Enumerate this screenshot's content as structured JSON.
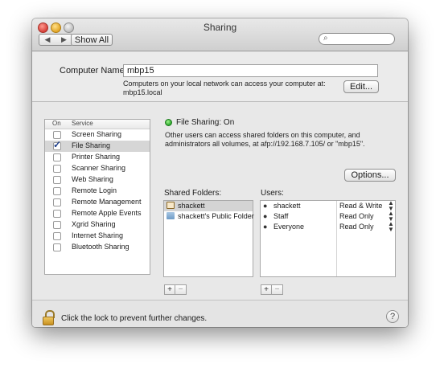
{
  "window": {
    "title": "Sharing"
  },
  "toolbar": {
    "back": "◀",
    "forward": "▶",
    "show_all": "Show All",
    "search_placeholder": ""
  },
  "computer_name": {
    "label": "Computer Name:",
    "value": "mbp15",
    "info_line1": "Computers on your local network can access your computer at:",
    "info_line2": "mbp15.local",
    "edit_label": "Edit..."
  },
  "services": {
    "header_on": "On",
    "header_service": "Service",
    "items": [
      {
        "label": "Screen Sharing",
        "on": false
      },
      {
        "label": "File Sharing",
        "on": true,
        "selected": true
      },
      {
        "label": "Printer Sharing",
        "on": false
      },
      {
        "label": "Scanner Sharing",
        "on": false
      },
      {
        "label": "Web Sharing",
        "on": false
      },
      {
        "label": "Remote Login",
        "on": false
      },
      {
        "label": "Remote Management",
        "on": false
      },
      {
        "label": "Remote Apple Events",
        "on": false
      },
      {
        "label": "Xgrid Sharing",
        "on": false
      },
      {
        "label": "Internet Sharing",
        "on": false
      },
      {
        "label": "Bluetooth Sharing",
        "on": false
      }
    ]
  },
  "detail": {
    "status": "File Sharing: On",
    "status_color": "#2aa52a",
    "description": "Other users can access shared folders on this computer, and administrators all volumes, at afp://192.168.7.105/ or \"mbp15\".",
    "options_label": "Options...",
    "shared_folders_label": "Shared Folders:",
    "users_label": "Users:",
    "folders": [
      {
        "name": "shackett",
        "icon": "home-icon",
        "selected": true
      },
      {
        "name": "shackett's Public Folder",
        "icon": "folder-icon",
        "selected": false
      }
    ],
    "users": [
      {
        "name": "shackett",
        "icon": "user-icon",
        "permission": "Read & Write"
      },
      {
        "name": "Staff",
        "icon": "group-icon",
        "permission": "Read Only"
      },
      {
        "name": "Everyone",
        "icon": "everyone-icon",
        "permission": "Read Only"
      }
    ],
    "add": "+",
    "remove": "−"
  },
  "footer": {
    "lock_text": "Click the lock to prevent further changes.",
    "help": "?"
  }
}
